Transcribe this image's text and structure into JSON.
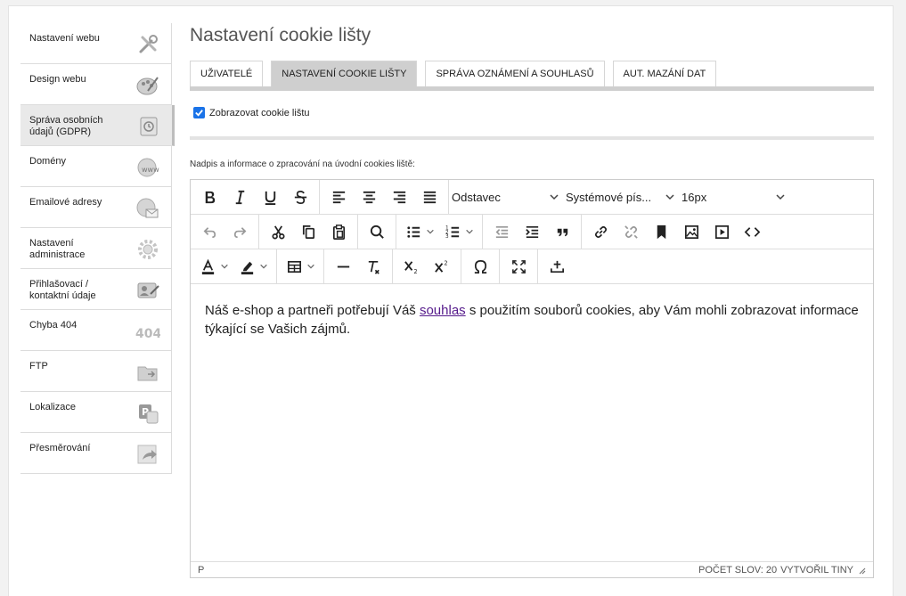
{
  "sidebar": {
    "items": [
      {
        "label": "Nastavení webu",
        "icon": "tools-icon"
      },
      {
        "label": "Design webu",
        "icon": "palette-icon"
      },
      {
        "label": "Správa osobních údajů (GDPR)",
        "icon": "safe-icon",
        "active": true
      },
      {
        "label": "Domény",
        "icon": "www-globe-icon"
      },
      {
        "label": "Emailové adresy",
        "icon": "email-globe-icon"
      },
      {
        "label": "Nastavení administrace",
        "icon": "gear-icon"
      },
      {
        "label": "Přihlašovací / kontaktní údaje",
        "icon": "contact-card-icon"
      },
      {
        "label": "Chyba 404",
        "icon": "error-404-icon"
      },
      {
        "label": "FTP",
        "icon": "ftp-folder-icon"
      },
      {
        "label": "Lokalizace",
        "icon": "localization-icon"
      },
      {
        "label": "Přesměrování",
        "icon": "redirect-icon"
      }
    ]
  },
  "page": {
    "title": "Nastavení cookie lišty"
  },
  "tabs": [
    {
      "label": "UŽIVATELÉ",
      "active": false
    },
    {
      "label": "NASTAVENÍ COOKIE LIŠTY",
      "active": true
    },
    {
      "label": "SPRÁVA OZNÁMENÍ A SOUHLASŮ",
      "active": false
    },
    {
      "label": "AUT. MAZÁNÍ DAT",
      "active": false
    }
  ],
  "checkbox": {
    "label": "Zobrazovat cookie lištu",
    "checked": true
  },
  "field": {
    "label": "Nadpis a informace o zpracování na úvodní cookies liště:"
  },
  "editor": {
    "block_format": "Odstavec",
    "font_family": "Systémové pís...",
    "font_size": "16px",
    "content": {
      "before": "Náš e-shop a partneři potřebují Váš ",
      "link": "souhlas",
      "after": " s použitím souborů cookies, aby Vám mohli zobrazovat informace týkající se Vašich zájmů."
    },
    "status": {
      "path": "P",
      "word_count": "POČET SLOV: 20",
      "brand": "VYTVOŘIL TINY"
    }
  },
  "colors": {
    "checkbox": "#1a73e8",
    "active_tab": "#cfcfcf",
    "link": "#551a8b"
  }
}
